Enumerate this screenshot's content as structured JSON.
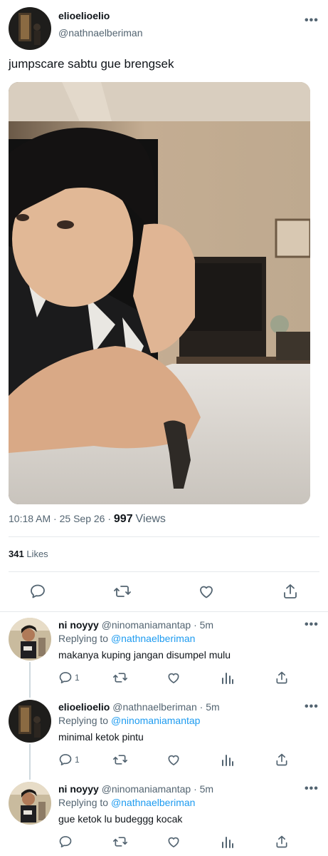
{
  "main_tweet": {
    "author_name": "elioelioelio",
    "author_handle": "@nathnaelberiman",
    "text": "jumpscare sabtu gue brengsek",
    "time": "10:18 AM",
    "date": "25 Sep 26",
    "dot": "·",
    "views_count": "997",
    "views_label": "Views",
    "likes_count": "341",
    "likes_label": "Likes",
    "more_label": "•••"
  },
  "replies": [
    {
      "author_name": "ni noyyy",
      "author_handle": "@ninomaniamantap",
      "time_ago": "· 5m",
      "replying_prefix": "Replying to",
      "replying_to": "@nathnaelberiman",
      "text": "makanya kuping jangan disumpel mulu",
      "reply_count": "1",
      "more_label": "•••"
    },
    {
      "author_name": "elioelioelio",
      "author_handle": "@nathnaelberiman",
      "time_ago": "· 5m",
      "replying_prefix": "Replying to",
      "replying_to": "@ninomaniamantap",
      "text": "minimal ketok pintu",
      "reply_count": "1",
      "more_label": "•••"
    },
    {
      "author_name": "ni noyyy",
      "author_handle": "@ninomaniamantap",
      "time_ago": "· 5m",
      "replying_prefix": "Replying to",
      "replying_to": "@nathnaelberiman",
      "text": "gue ketok lu budeggg kocak",
      "reply_count": "",
      "more_label": "•••"
    }
  ],
  "icons": {
    "reply": "reply-icon",
    "retweet": "retweet-icon",
    "like": "like-icon",
    "views": "views-icon",
    "share": "share-icon"
  },
  "colors": {
    "link": "#1d9bf0",
    "secondary_text": "#536471",
    "primary_text": "#0f1419",
    "divider": "#e6e9ec"
  }
}
